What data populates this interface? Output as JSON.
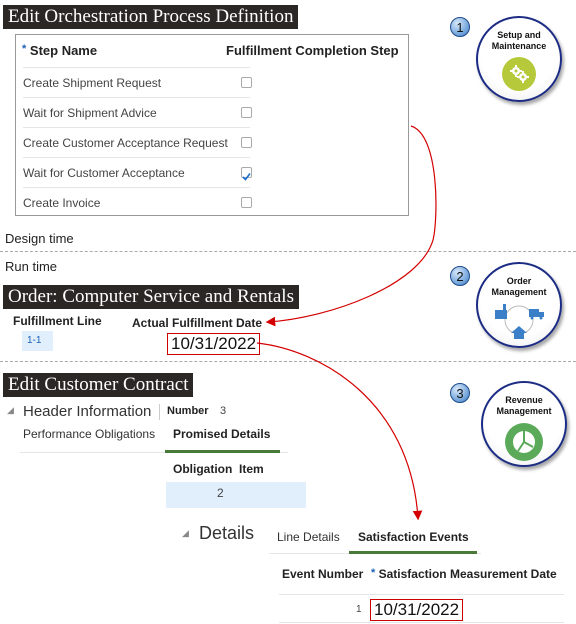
{
  "sections": {
    "design": {
      "banner": "Edit Orchestration Process Definition",
      "table": {
        "col_step": "Step Name",
        "col_step_required": "*",
        "col_completion": "Fulfillment Completion Step",
        "rows": [
          {
            "step": "Create Shipment Request",
            "checked": false
          },
          {
            "step": "Wait for Shipment Advice",
            "checked": false
          },
          {
            "step": "Create Customer Acceptance Request",
            "checked": false
          },
          {
            "step": "Wait for Customer Acceptance",
            "checked": true
          },
          {
            "step": "Create Invoice",
            "checked": false
          }
        ]
      },
      "badge": "1",
      "app": {
        "title_line1": "Setup and",
        "title_line2": "Maintenance",
        "icon": "gears-icon",
        "color": "#b5c93a"
      }
    },
    "design_label": "Design time",
    "run_label": "Run time",
    "order": {
      "banner": "Order: Computer Service and Rentals",
      "col_line": "Fulfillment Line",
      "col_date": "Actual Fulfillment Date",
      "line_value": "1-1",
      "date_value": "10/31/2022",
      "badge": "2",
      "app": {
        "title_line1": "Order",
        "title_line2": "Management",
        "icon": "supply-chain-icon",
        "color": "#3a7fc8"
      }
    },
    "contract": {
      "banner": "Edit Customer Contract",
      "header_label": "Header Information",
      "number_label": "Number",
      "number_value": "3",
      "tabs": [
        {
          "label": "Performance Obligations",
          "selected": false
        },
        {
          "label": "Promised Details",
          "selected": true
        }
      ],
      "obligation_col": "Obligation  Item",
      "obligation_value": "2",
      "details_label": "Details",
      "detail_tabs": [
        {
          "label": "Line Details",
          "selected": false
        },
        {
          "label": "Satisfaction Events",
          "selected": true
        }
      ],
      "col_event": "Event Number",
      "col_date": "Satisfaction Measurement Date",
      "col_date_required": "*",
      "event_value": "1",
      "date_value": "10/31/2022",
      "badge": "3",
      "app": {
        "title_line1": "Revenue",
        "title_line2": "Management",
        "icon": "pie-chart-icon",
        "color": "#5aaa5a"
      }
    }
  },
  "colors": {
    "arrow": "#d40000",
    "banner_bg": "#2b2724",
    "tab_selected": "#4a7a3a",
    "selected_row": "#e1effc"
  }
}
